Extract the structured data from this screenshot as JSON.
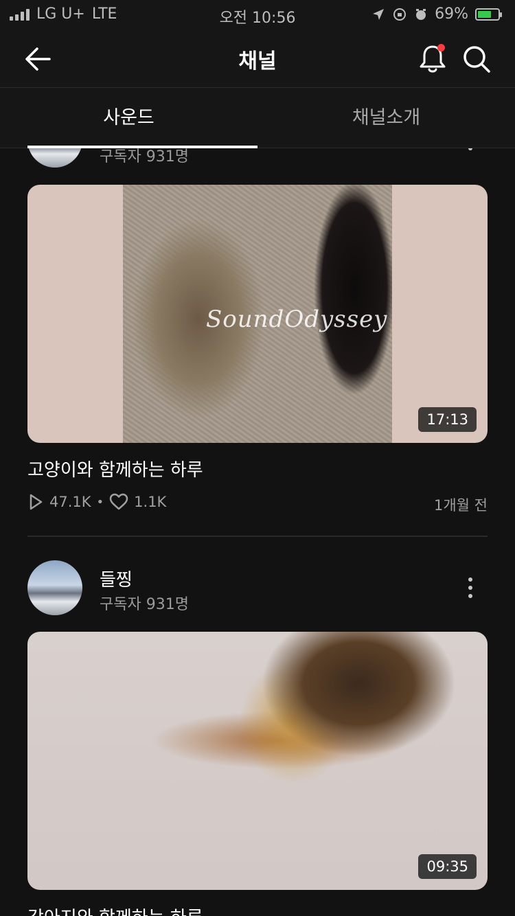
{
  "status_bar": {
    "carrier": "LG U+",
    "network": "LTE",
    "time": "오전 10:56",
    "battery_percent": "69%",
    "battery_level": 0.69
  },
  "header": {
    "title": "채널"
  },
  "tabs": [
    {
      "label": "사운드",
      "active": true
    },
    {
      "label": "채널소개",
      "active": false
    }
  ],
  "posts": [
    {
      "channel_name": "",
      "subscribers": "구독자 931명",
      "thumbnail_watermark": "SoundOdyssey",
      "duration": "17:13",
      "title": "고양이와 함께하는 하루",
      "plays": "47.1K",
      "likes": "1.1K",
      "date": "1개월 전"
    },
    {
      "channel_name": "들찡",
      "subscribers": "구독자 931명",
      "duration": "09:35",
      "title": "강아지와 함께하는 하루"
    }
  ],
  "colors": {
    "background": "#121212",
    "header": "#161616",
    "notification_dot": "#ff3b3b",
    "battery_fill": "#37c94c"
  }
}
